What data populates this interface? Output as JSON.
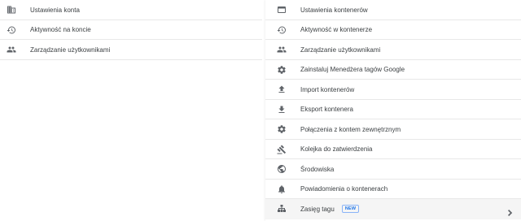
{
  "account_menu": {
    "items": [
      {
        "label": "Ustawienia konta",
        "icon": "building-icon"
      },
      {
        "label": "Aktywność na koncie",
        "icon": "history-icon"
      },
      {
        "label": "Zarządzanie użytkownikami",
        "icon": "people-icon"
      }
    ]
  },
  "container_menu": {
    "items": [
      {
        "label": "Ustawienia kontenerów",
        "icon": "container-icon"
      },
      {
        "label": "Aktywność w kontenerze",
        "icon": "history-icon"
      },
      {
        "label": "Zarządzanie użytkownikami",
        "icon": "people-icon"
      },
      {
        "label": "Zainstaluj Menedżera tagów Google",
        "icon": "gear-icon"
      },
      {
        "label": "Import kontenerów",
        "icon": "upload-icon"
      },
      {
        "label": "Eksport kontenera",
        "icon": "download-icon"
      },
      {
        "label": "Połączenia z kontem zewnętrznym",
        "icon": "gear-icon"
      },
      {
        "label": "Kolejka do zatwierdzenia",
        "icon": "gavel-icon"
      },
      {
        "label": "Środowiska",
        "icon": "globe-icon"
      },
      {
        "label": "Powiadomienia o kontenerach",
        "icon": "bell-icon"
      },
      {
        "label": "Zasięg tagu",
        "icon": "sitemap-icon",
        "badge": "NEW",
        "chevron": "chevron-right-icon"
      }
    ]
  },
  "colors": {
    "icon": "#5f6368",
    "text": "#3c4043",
    "badge": "#1a73e8",
    "divider": "#e8e8e8"
  }
}
